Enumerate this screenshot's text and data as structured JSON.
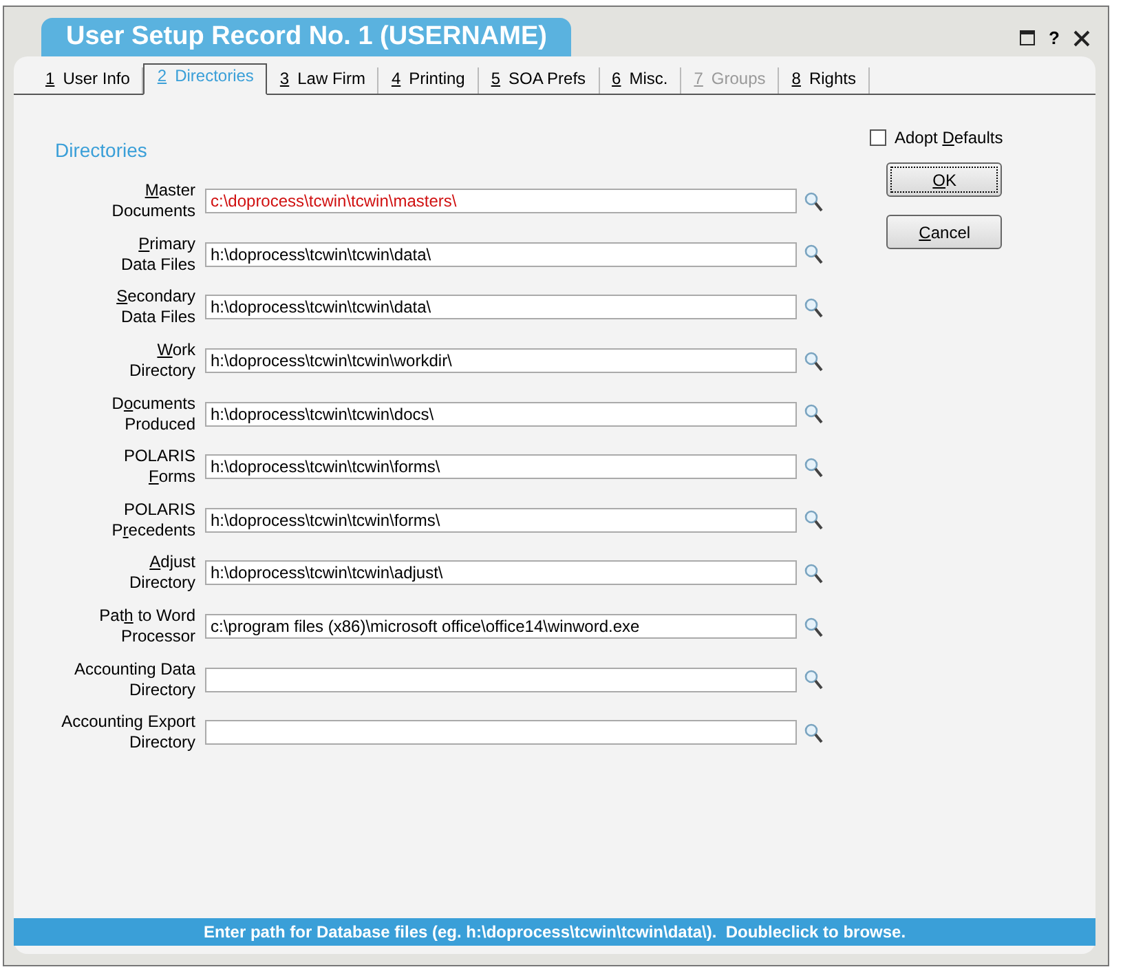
{
  "window": {
    "title": "User Setup Record No. 1 (USERNAME)",
    "controls": [
      {
        "kind": "maximize"
      },
      {
        "kind": "help",
        "text": "?"
      },
      {
        "kind": "close"
      }
    ]
  },
  "tabs": [
    {
      "number": "1",
      "label": "User Info",
      "selected": false,
      "disabled": false
    },
    {
      "number": "2",
      "label": "Directories",
      "selected": true,
      "disabled": false
    },
    {
      "number": "3",
      "label": "Law Firm",
      "selected": false,
      "disabled": false
    },
    {
      "number": "4",
      "label": "Printing",
      "selected": false,
      "disabled": false
    },
    {
      "number": "5",
      "label": "SOA Prefs",
      "selected": false,
      "disabled": false
    },
    {
      "number": "6",
      "label": "Misc.",
      "selected": false,
      "disabled": false
    },
    {
      "number": "7",
      "label": "Groups",
      "selected": false,
      "disabled": true
    },
    {
      "number": "8",
      "label": "Rights",
      "selected": false,
      "disabled": false
    }
  ],
  "section_title": "Directories",
  "fields": [
    {
      "label": [
        {
          "key": "M",
          "post": "aster"
        },
        {
          "pre": "Documents"
        }
      ],
      "value": "c:\\doprocess\\tcwin\\tcwin\\masters\\",
      "highlighted": true
    },
    {
      "label": [
        {
          "key": "P",
          "post": "rimary"
        },
        {
          "pre": "Data Files"
        }
      ],
      "value": "h:\\doprocess\\tcwin\\tcwin\\data\\",
      "highlighted": false
    },
    {
      "label": [
        {
          "key": "S",
          "post": "econdary"
        },
        {
          "pre": "Data Files"
        }
      ],
      "value": "h:\\doprocess\\tcwin\\tcwin\\data\\",
      "highlighted": false
    },
    {
      "label": [
        {
          "key": "W",
          "post": "ork"
        },
        {
          "pre": "Directory"
        }
      ],
      "value": "h:\\doprocess\\tcwin\\tcwin\\workdir\\",
      "highlighted": false
    },
    {
      "label": [
        {
          "pre": "D",
          "key": "o",
          "post": "cuments"
        },
        {
          "pre": "Produced"
        }
      ],
      "value": "h:\\doprocess\\tcwin\\tcwin\\docs\\",
      "highlighted": false
    },
    {
      "label": [
        {
          "pre": "POLARIS"
        },
        {
          "key": "F",
          "post": "orms"
        }
      ],
      "value": "h:\\doprocess\\tcwin\\tcwin\\forms\\",
      "highlighted": false
    },
    {
      "label": [
        {
          "pre": "POLARIS"
        },
        {
          "pre": "P",
          "key": "r",
          "post": "ecedents"
        }
      ],
      "value": "h:\\doprocess\\tcwin\\tcwin\\forms\\",
      "highlighted": false
    },
    {
      "label": [
        {
          "key": "A",
          "post": "djust"
        },
        {
          "pre": "Directory"
        }
      ],
      "value": "h:\\doprocess\\tcwin\\tcwin\\adjust\\",
      "highlighted": false
    },
    {
      "label": [
        {
          "pre": "Pat",
          "key": "h",
          "post": " to Word"
        },
        {
          "pre": "Processor"
        }
      ],
      "value": "c:\\program files (x86)\\microsoft office\\office14\\winword.exe",
      "highlighted": false
    },
    {
      "label": [
        {
          "pre": "Accounting Data"
        },
        {
          "pre": "Directory"
        }
      ]
    },
    {
      "label": [
        {
          "pre": "Accounting Export"
        },
        {
          "pre": "Directory"
        }
      ]
    }
  ],
  "adopt_defaults": {
    "label": {
      "pre": "Adopt ",
      "key": "D",
      "post": "efaults"
    },
    "checked": false
  },
  "buttons": [
    {
      "label": {
        "key": "O",
        "post": "K"
      },
      "focused": true
    },
    {
      "label": {
        "key": "C",
        "post": "ancel"
      },
      "focused": false
    }
  ],
  "status_bar": "Enter path for Database files (eg. h:\\doprocess\\tcwin\\tcwin\\data\\).  Doubleclick to browse."
}
